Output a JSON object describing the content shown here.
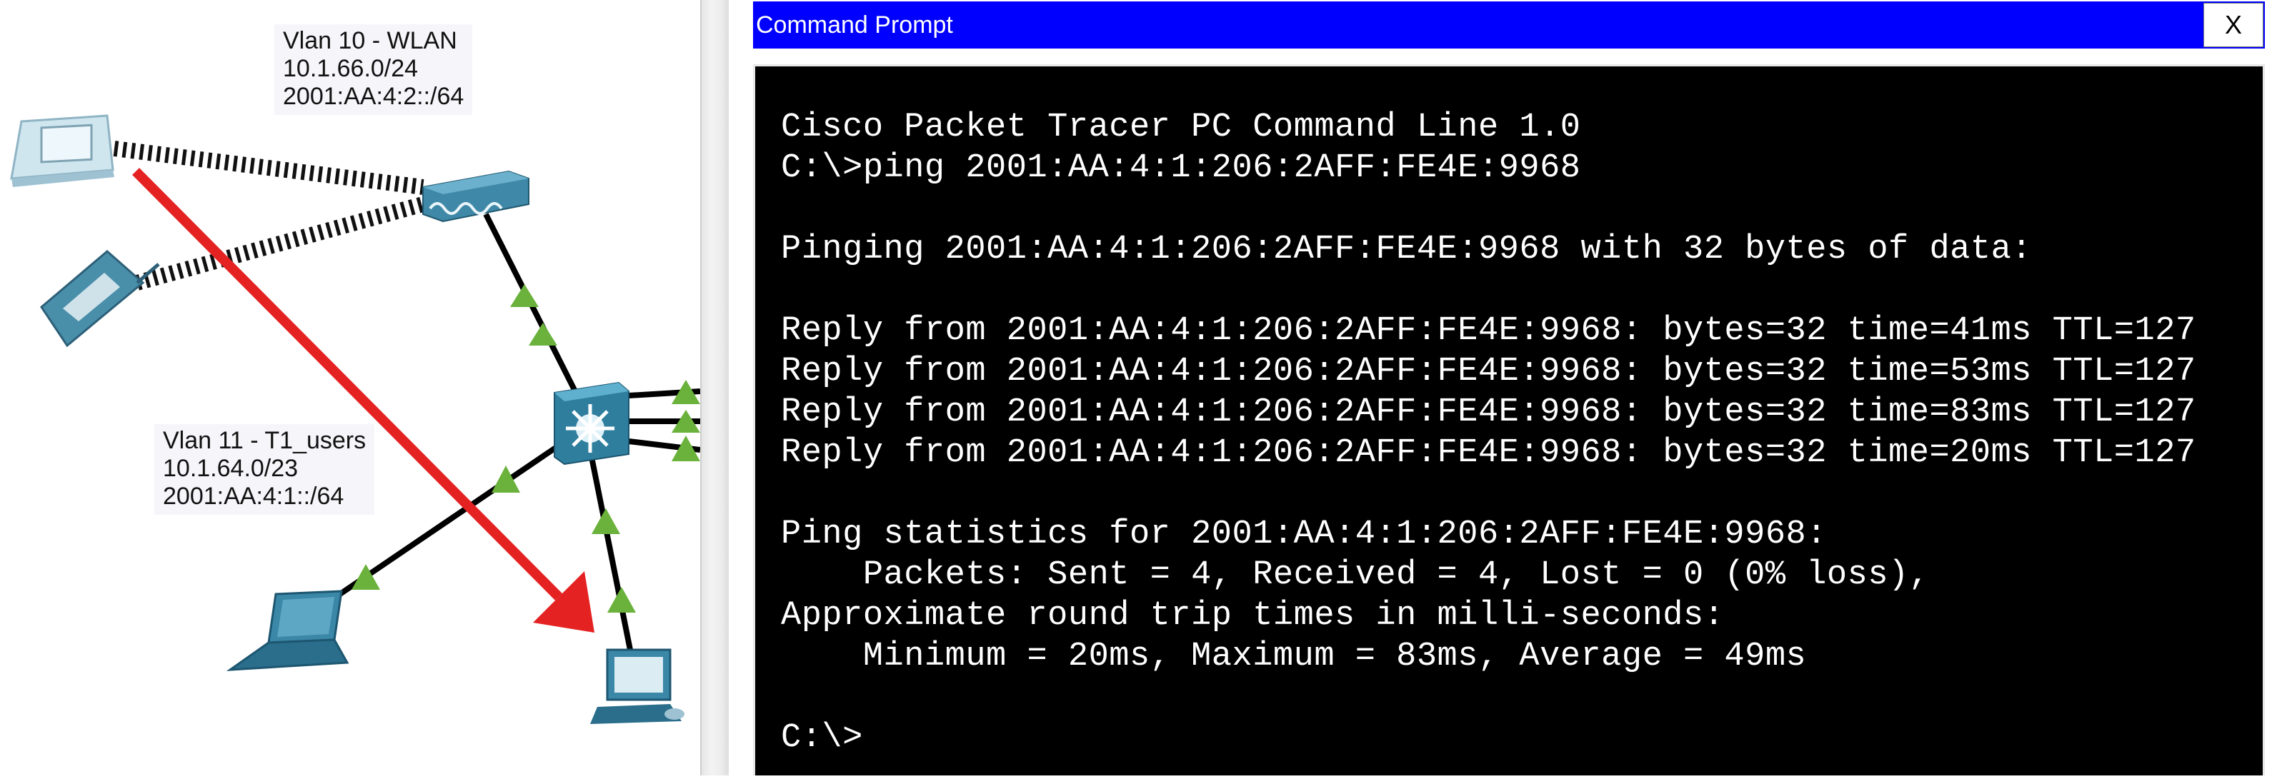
{
  "topology": {
    "vlan10_label": "Vlan 10 - WLAN\n10.1.66.0/24\n2001:AA:4:2::/64",
    "vlan11_label": "Vlan 11 - T1_users\n10.1.64.0/23\n2001:AA:4:1::/64",
    "devices": [
      "tablet-icon",
      "pda-icon",
      "access-point-icon",
      "multilayer-switch-icon",
      "laptop-icon",
      "pc-icon"
    ],
    "arrow_color": "#e52222",
    "link_up_color": "#6ab23b"
  },
  "window": {
    "title": "Command Prompt",
    "close_label": "X",
    "title_bar_color": "#0000ff"
  },
  "console": {
    "lines": [
      "Cisco Packet Tracer PC Command Line 1.0",
      "C:\\>ping 2001:AA:4:1:206:2AFF:FE4E:9968",
      "",
      "Pinging 2001:AA:4:1:206:2AFF:FE4E:9968 with 32 bytes of data:",
      "",
      "Reply from 2001:AA:4:1:206:2AFF:FE4E:9968: bytes=32 time=41ms TTL=127",
      "Reply from 2001:AA:4:1:206:2AFF:FE4E:9968: bytes=32 time=53ms TTL=127",
      "Reply from 2001:AA:4:1:206:2AFF:FE4E:9968: bytes=32 time=83ms TTL=127",
      "Reply from 2001:AA:4:1:206:2AFF:FE4E:9968: bytes=32 time=20ms TTL=127",
      "",
      "Ping statistics for 2001:AA:4:1:206:2AFF:FE4E:9968:",
      "    Packets: Sent = 4, Received = 4, Lost = 0 (0% loss),",
      "Approximate round trip times in milli-seconds:",
      "    Minimum = 20ms, Maximum = 83ms, Average = 49ms",
      "",
      "C:\\>"
    ]
  }
}
